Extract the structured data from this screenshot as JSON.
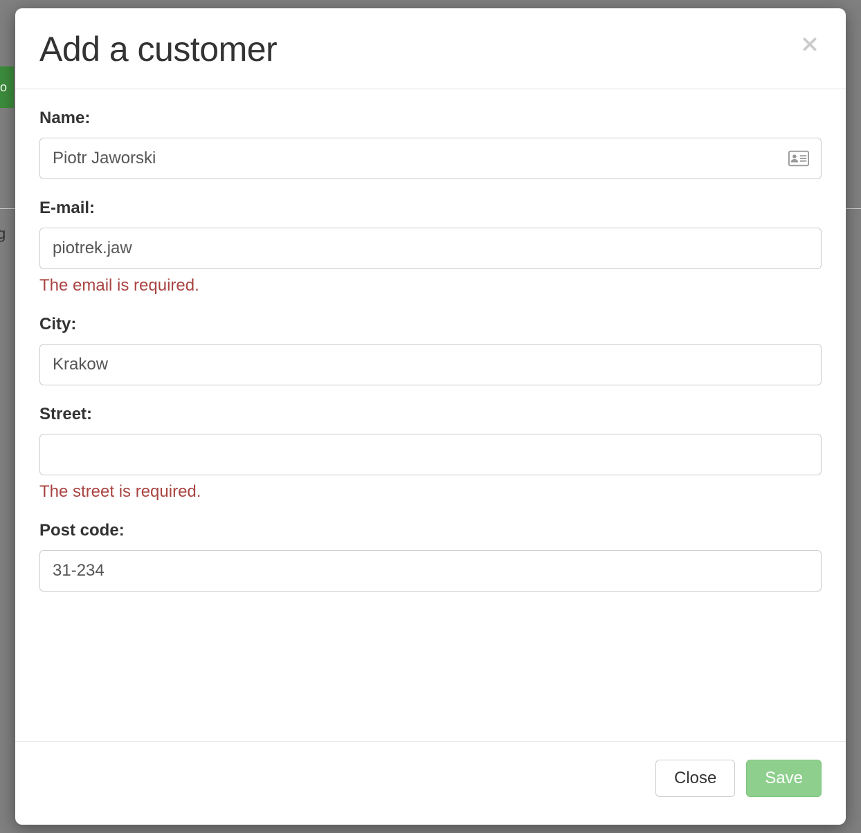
{
  "modal": {
    "title": "Add a customer",
    "fields": {
      "name": {
        "label": "Name:",
        "value": "Piotr Jaworski"
      },
      "email": {
        "label": "E-mail:",
        "value": "piotrek.jaw",
        "error": "The email is required."
      },
      "city": {
        "label": "City:",
        "value": "Krakow"
      },
      "street": {
        "label": "Street:",
        "value": "",
        "error": "The street is required."
      },
      "postcode": {
        "label": "Post code:",
        "value": "31-234"
      }
    },
    "buttons": {
      "close": "Close",
      "save": "Save"
    }
  },
  "background": {
    "green_fragment": "o",
    "text_fragment": "g"
  }
}
